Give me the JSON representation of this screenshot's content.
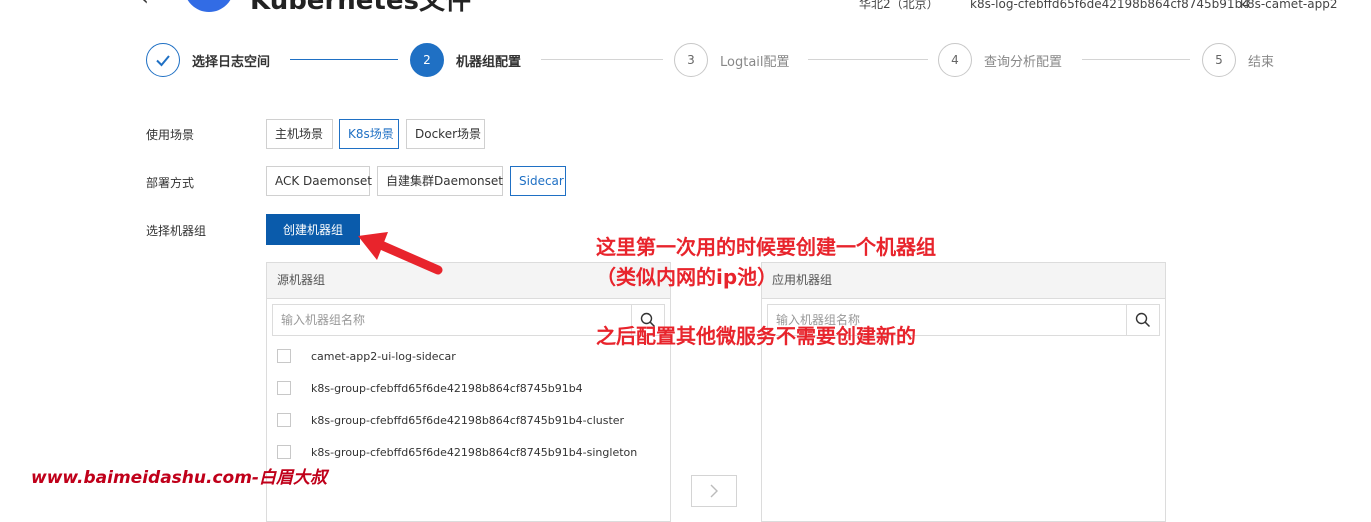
{
  "header": {
    "app_title": "Kubernetes文件",
    "region": "华北2（北京）",
    "project": "k8s-log-cfebffd65f6de42198b864cf8745b91b4",
    "logstore": "k8s-camet-app2"
  },
  "steps": [
    {
      "index": "1",
      "label": "选择日志空间",
      "state": "done"
    },
    {
      "index": "2",
      "label": "机器组配置",
      "state": "active"
    },
    {
      "index": "3",
      "label": "Logtail配置",
      "state": "pending"
    },
    {
      "index": "4",
      "label": "查询分析配置",
      "state": "pending"
    },
    {
      "index": "5",
      "label": "结束",
      "state": "pending"
    }
  ],
  "scenario": {
    "label": "使用场景",
    "options": [
      "主机场景",
      "K8s场景",
      "Docker场景"
    ],
    "selected": "K8s场景"
  },
  "deploy": {
    "label": "部署方式",
    "options": [
      "ACK Daemonset",
      "自建集群Daemonset",
      "Sidecar"
    ],
    "selected": "Sidecar"
  },
  "machine_group": {
    "label": "选择机器组",
    "create_button": "创建机器组"
  },
  "source_panel": {
    "title": "源机器组",
    "search_placeholder": "输入机器组名称",
    "items": [
      "camet-app2-ui-log-sidecar",
      "k8s-group-cfebffd65f6de42198b864cf8745b91b4",
      "k8s-group-cfebffd65f6de42198b864cf8745b91b4-cluster",
      "k8s-group-cfebffd65f6de42198b864cf8745b91b4-singleton"
    ]
  },
  "target_panel": {
    "title": "应用机器组",
    "search_placeholder": "输入机器组名称"
  },
  "annotations": {
    "line1": "这里第一次用的时候要创建一个机器组",
    "line2": "（类似内网的ip池）",
    "line3": "之后配置其他微服务不需要创建新的",
    "watermark": "www.baimeidashu.com-白眉大叔"
  },
  "colors": {
    "primary": "#0a5bab",
    "accent": "#1f70c4",
    "annotation": "#e8242c",
    "watermark": "#c0001a"
  }
}
